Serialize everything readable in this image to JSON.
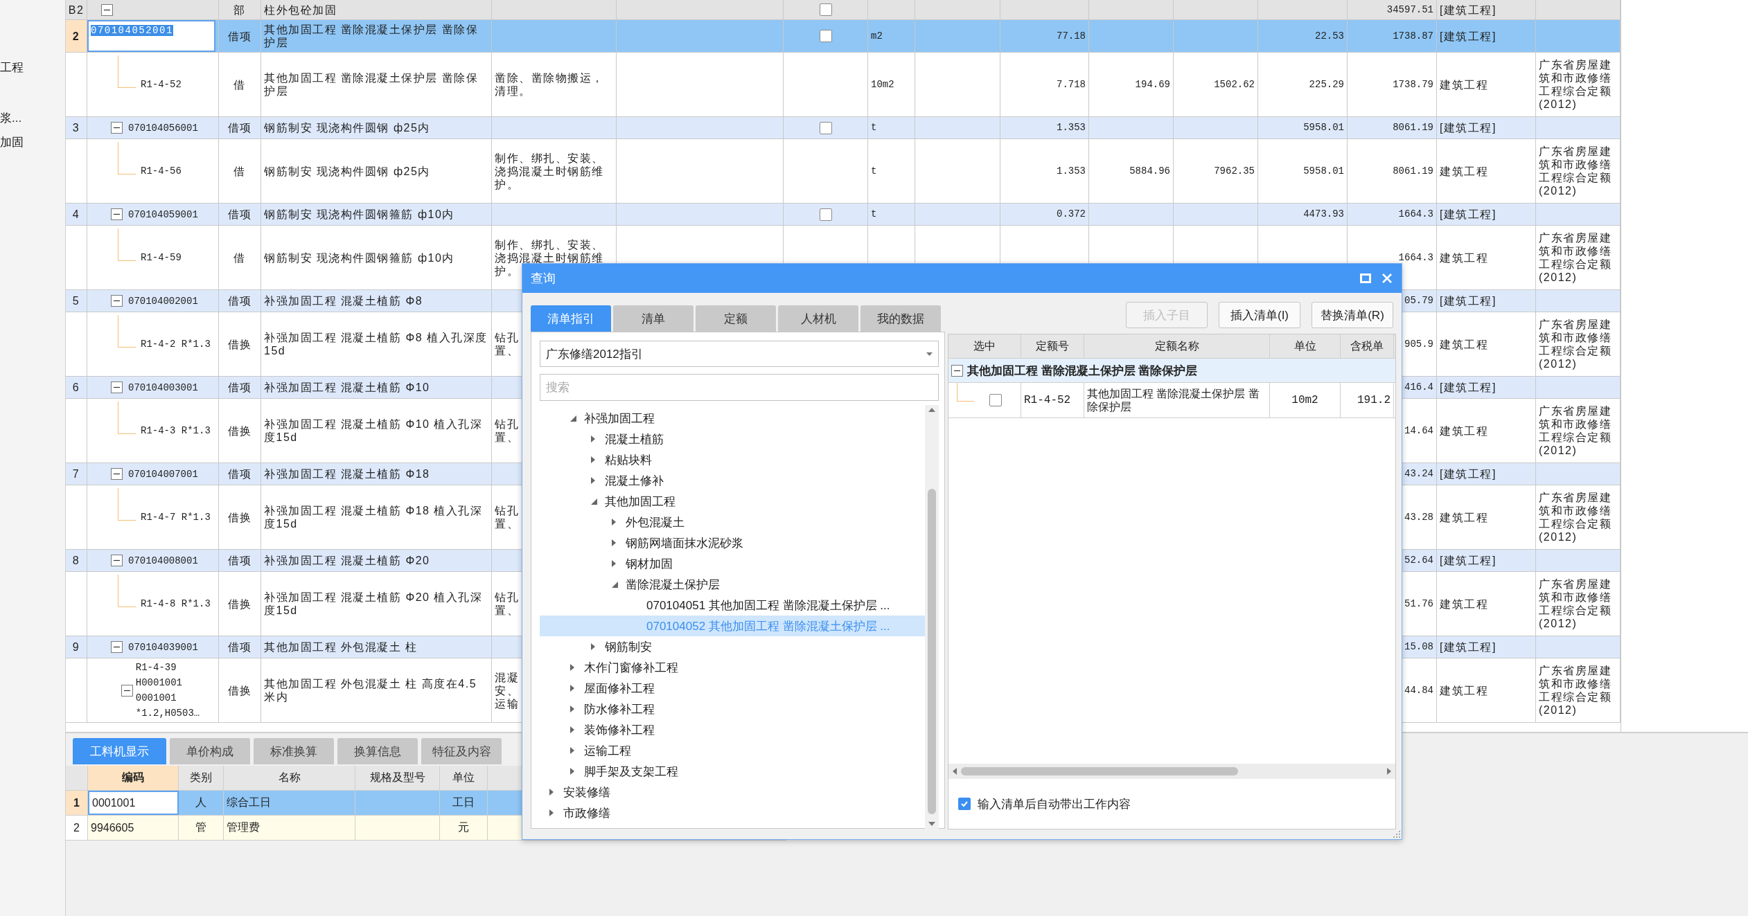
{
  "sidebar": {
    "items": [
      "工程",
      "浆...",
      "加固"
    ]
  },
  "table": {
    "rows": [
      {
        "kind": "section",
        "expanded": true,
        "checked": false,
        "selected": false,
        "column_1": "B2",
        "column_3": "部",
        "column_4": "柱外包砼加固",
        "column_14": "34597.51",
        "column_15": "[建筑工程]"
      },
      {
        "kind": "group",
        "expanded": false,
        "checked": false,
        "selected": true,
        "column_1": "2",
        "column_2": "070104052001",
        "column_3": "借项",
        "column_4": "其他加固工程 凿除混凝土保护层 凿除保护层",
        "column_8": "m2",
        "column_10": "77.18",
        "column_13": "22.53",
        "column_14": "1738.87",
        "column_15": "[建筑工程]"
      },
      {
        "kind": "item",
        "expanded": false,
        "selected": false,
        "column_2": "R1-4-52",
        "column_3": "借",
        "column_4": "其他加固工程 凿除混凝土保护层 凿除保护层",
        "column_5": "凿除、凿除物搬运，清理。",
        "column_8": "10m2",
        "column_10": "7.718",
        "column_11": "194.69",
        "column_12": "1502.62",
        "column_13": "225.29",
        "column_14": "1738.79",
        "column_15": "建筑工程",
        "column_16": "广东省房屋建筑和市政修缮工程综合定额(2012)"
      },
      {
        "kind": "group",
        "expanded": true,
        "checked": false,
        "selected": false,
        "column_1": "3",
        "column_2": "070104056001",
        "column_3": "借项",
        "column_4": "钢筋制安 现浇构件圆钢 ф25内",
        "column_8": "t",
        "column_10": "1.353",
        "column_13": "5958.01",
        "column_14": "8061.19",
        "column_15": "[建筑工程]"
      },
      {
        "kind": "item",
        "expanded": false,
        "selected": false,
        "column_2": "R1-4-56",
        "column_3": "借",
        "column_4": "钢筋制安 现浇构件圆钢 ф25内",
        "column_5": "制作、绑扎、安装、浇捣混凝土时钢筋维护。",
        "column_8": "t",
        "column_10": "1.353",
        "column_11": "5884.96",
        "column_12": "7962.35",
        "column_13": "5958.01",
        "column_14": "8061.19",
        "column_15": "建筑工程",
        "column_16": "广东省房屋建筑和市政修缮工程综合定额(2012)"
      },
      {
        "kind": "group",
        "expanded": true,
        "checked": false,
        "selected": false,
        "column_1": "4",
        "column_2": "070104059001",
        "column_3": "借项",
        "column_4": "钢筋制安 现浇构件圆钢箍筋 ф10内",
        "column_8": "t",
        "column_10": "0.372",
        "column_13": "4473.93",
        "column_14": "1664.3",
        "column_15": "[建筑工程]"
      },
      {
        "kind": "item",
        "expanded": false,
        "selected": false,
        "column_2": "R1-4-59",
        "column_3": "借",
        "column_4": "钢筋制安 现浇构件圆钢箍筋 ф10内",
        "column_5": "制作、绑扎、安装、浇捣混凝土时钢筋维护。",
        "column_14": "1664.3",
        "column_15": "建筑工程",
        "column_16": "广东省房屋建筑和市政修缮工程综合定额(2012)"
      },
      {
        "kind": "group",
        "expanded": true,
        "selected": false,
        "column_1": "5",
        "column_2": "070104002001",
        "column_3": "借项",
        "column_4": "补强加固工程 混凝土植筋 Φ8",
        "column_14": "05.79",
        "column_15": "[建筑工程]"
      },
      {
        "kind": "item",
        "expanded": false,
        "covered": true,
        "selected": false,
        "column_2": "R1-4-2 R*1.3",
        "column_3": "借换",
        "column_4": "补强加固工程 混凝土植筋 Φ8  植入孔深度15d",
        "column_5": "钻孔置、",
        "column_14": "905.9",
        "column_15": "建筑工程",
        "column_16": "广东省房屋建筑和市政修缮工程综合定额(2012)"
      },
      {
        "kind": "group",
        "expanded": true,
        "selected": false,
        "column_1": "6",
        "column_2": "070104003001",
        "column_3": "借项",
        "column_4": "补强加固工程 混凝土植筋 Φ10",
        "column_14": "416.4",
        "column_15": "[建筑工程]"
      },
      {
        "kind": "item",
        "expanded": false,
        "covered": true,
        "selected": false,
        "column_2": "R1-4-3 R*1.3",
        "column_3": "借换",
        "column_4": "补强加固工程 混凝土植筋 Φ10  植入孔深度15d",
        "column_5": "钻孔置、",
        "column_14": "14.64",
        "column_15": "建筑工程",
        "column_16": "广东省房屋建筑和市政修缮工程综合定额(2012)"
      },
      {
        "kind": "group",
        "expanded": true,
        "selected": false,
        "column_1": "7",
        "column_2": "070104007001",
        "column_3": "借项",
        "column_4": "补强加固工程 混凝土植筋 Φ18",
        "column_14": "43.24",
        "column_15": "[建筑工程]"
      },
      {
        "kind": "item",
        "expanded": false,
        "covered": true,
        "selected": false,
        "column_2": "R1-4-7 R*1.3",
        "column_3": "借换",
        "column_4": "补强加固工程 混凝土植筋 Φ18  植入孔深度15d",
        "column_5": "钻孔置、",
        "column_14": "43.28",
        "column_15": "建筑工程",
        "column_16": "广东省房屋建筑和市政修缮工程综合定额(2012)"
      },
      {
        "kind": "group",
        "expanded": true,
        "selected": false,
        "column_1": "8",
        "column_2": "070104008001",
        "column_3": "借项",
        "column_4": "补强加固工程 混凝土植筋 Φ20",
        "column_14": "52.64",
        "column_15": "[建筑工程]"
      },
      {
        "kind": "item",
        "expanded": false,
        "covered": true,
        "selected": false,
        "column_2": "R1-4-8 R*1.3",
        "column_3": "借换",
        "column_4": "补强加固工程 混凝土植筋 Φ20  植入孔深度15d",
        "column_5": "钻孔置、",
        "column_14": "51.76",
        "column_15": "建筑工程",
        "column_16": "广东省房屋建筑和市政修缮工程综合定额(2012)"
      },
      {
        "kind": "group",
        "expanded": true,
        "selected": false,
        "column_1": "9",
        "column_2": "070104039001",
        "column_3": "借项",
        "column_4": "其他加固工程 外包混凝土 柱",
        "column_14": "15.08",
        "column_15": "[建筑工程]"
      },
      {
        "kind": "item",
        "expanded": true,
        "covered": true,
        "selected": false,
        "column_2": "R1-4-39 H0001001 0001001 *1.2,H0503…",
        "column_3": "借换",
        "column_4": "其他加固工程 外包混凝土 柱  高度在4.5米内",
        "column_5": "混凝安、运输",
        "column_14": "44.84",
        "column_15": "建筑工程",
        "column_16": "广东省房屋建筑和市政修缮工程综合定额(2012)"
      }
    ]
  },
  "detail_panel": {
    "tabs": [
      {
        "label": "工料机显示",
        "selected": true
      },
      {
        "label": "单价构成",
        "selected": false
      },
      {
        "label": "标准换算",
        "selected": false
      },
      {
        "label": "换算信息",
        "selected": false
      },
      {
        "label": "特征及内容",
        "selected": false
      }
    ],
    "columns": [
      {
        "label": "编码",
        "selected": true
      },
      {
        "label": "类别",
        "selected": false
      },
      {
        "label": "名称",
        "selected": false
      },
      {
        "label": "规格及型号",
        "selected": false
      },
      {
        "label": "单位",
        "selected": false
      }
    ],
    "rows": [
      {
        "selected": true,
        "number": "1",
        "code": "0001001",
        "category": "人",
        "name": "综合工日",
        "unit": "工日"
      },
      {
        "selected": false,
        "number": "2",
        "code": "9946605",
        "category": "管",
        "name": "管理费",
        "unit": "元"
      }
    ]
  },
  "dialog": {
    "title": "查询",
    "tabs": [
      {
        "label": "清单指引",
        "selected": true
      },
      {
        "label": "清单",
        "selected": false
      },
      {
        "label": "定额",
        "selected": false
      },
      {
        "label": "人材机",
        "selected": false
      },
      {
        "label": "我的数据",
        "selected": false
      }
    ],
    "library": {
      "value": "广东修缮2012指引"
    },
    "search": {
      "placeholder": "搜索"
    },
    "tree": [
      {
        "children": [
          {
            "label": "补强加固工程",
            "expanded": true,
            "selected": false,
            "children": [
              {
                "label": "混凝土植筋",
                "expanded": false,
                "selected": false
              },
              {
                "label": "粘贴块料",
                "expanded": false,
                "selected": false
              },
              {
                "label": "混凝土修补",
                "expanded": false,
                "selected": false
              },
              {
                "label": "其他加固工程",
                "expanded": true,
                "selected": false,
                "children": [
                  {
                    "label": "外包混凝土",
                    "expanded": false,
                    "selected": false
                  },
                  {
                    "label": "钢筋网墙面抹水泥砂浆",
                    "expanded": false,
                    "selected": false
                  },
                  {
                    "label": "钢材加固",
                    "expanded": false,
                    "selected": false
                  },
                  {
                    "label": "凿除混凝土保护层",
                    "expanded": true,
                    "selected": false,
                    "children": [
                      {
                        "label": "070104051  其他加固工程 凿除混凝土保护层 ...",
                        "selected": false
                      },
                      {
                        "label": "070104052  其他加固工程 凿除混凝土保护层 ...",
                        "selected": true
                      }
                    ]
                  }
                ]
              },
              {
                "label": "钢筋制安",
                "expanded": false,
                "selected": false
              }
            ]
          },
          {
            "label": "木作门窗修补工程",
            "expanded": false,
            "selected": false
          },
          {
            "label": "屋面修补工程",
            "expanded": false,
            "selected": false
          },
          {
            "label": "防水修补工程",
            "expanded": false,
            "selected": false
          },
          {
            "label": "装饰修补工程",
            "expanded": false,
            "selected": false
          },
          {
            "label": "运输工程",
            "expanded": false,
            "selected": false
          },
          {
            "label": "脚手架及支架工程",
            "expanded": false,
            "selected": false
          }
        ]
      },
      {
        "label": "安装修缮",
        "expanded": false,
        "selected": false
      },
      {
        "label": "市政修缮",
        "expanded": false,
        "selected": false
      }
    ],
    "buttons": [
      {
        "label": "插入子目",
        "disabled": true
      },
      {
        "label": "插入清单(I)",
        "disabled": false
      },
      {
        "label": "替换清单(R)",
        "disabled": false
      }
    ],
    "grid": {
      "columns": [
        "选中",
        "定额号",
        "定额名称",
        "单位",
        "含税单"
      ],
      "groups": [
        {
          "label": "其他加固工程  凿除混凝土保护层  凿除保护层",
          "expanded": true,
          "rows": [
            {
              "checked": false,
              "code": "R1-4-52",
              "name": "其他加固工程 凿除混凝土保护层 凿除保护层",
              "unit": "10m2",
              "price": "191.2"
            }
          ]
        }
      ]
    },
    "auto_fill": {
      "label": "输入清单后自动带出工作内容",
      "checked": true
    }
  }
}
